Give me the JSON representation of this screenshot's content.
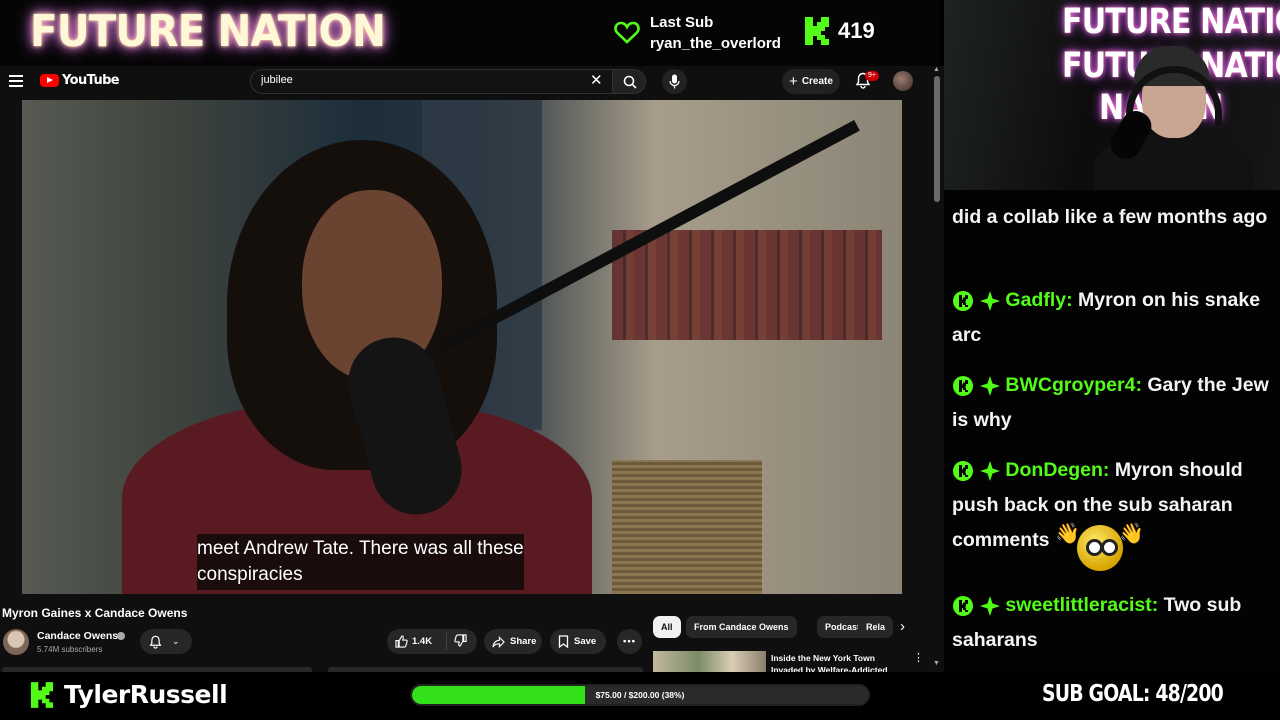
{
  "overlay": {
    "brand": "FUTURE NATION",
    "last_sub_label": "Last Sub",
    "last_sub_user": "ryan_the_overlord",
    "viewer_count": "419",
    "accent_color": "#53fc18",
    "streamer_name": "TylerRussell",
    "donation_text": "$75.00 / $200.00 (38%)",
    "donation_fraction": 0.38,
    "sub_goal": "SUB GOAL: 48/200"
  },
  "webcam": {
    "neon_lines": [
      "FUTURE NATION",
      "FUTURE NATION",
      "NATION"
    ]
  },
  "youtube": {
    "logo_text": "YouTube",
    "search": {
      "value": "jubilee"
    },
    "create_label": "Create",
    "notification_badge": "9+",
    "video": {
      "subtitle_line1": "meet Andrew Tate. There was all these",
      "subtitle_line2": "conspiracies",
      "title": "Myron Gaines x Candace Owens",
      "channel": "Candace Owens",
      "subscribers": "5.74M subscribers",
      "likes": "1.4K",
      "share_label": "Share",
      "save_label": "Save"
    },
    "chips": [
      "All",
      "From Candace Owens",
      "Podcasts",
      "Rela"
    ],
    "recommendation": {
      "title": "Inside the New York Town Invaded by Welfare-Addicted"
    }
  },
  "chat": {
    "messages": [
      {
        "user": "",
        "text": "did a collab like a few months ago"
      },
      {
        "user": "Gadfly:",
        "text": "Myron on his snake arc"
      },
      {
        "user": "BWCgroyper4:",
        "text": "Gary the Jew is why"
      },
      {
        "user": "DonDegen:",
        "text": "Myron should push back on the sub saharan comments"
      },
      {
        "user": "sweetlittleracist:",
        "text": "Two sub saharans"
      }
    ]
  }
}
